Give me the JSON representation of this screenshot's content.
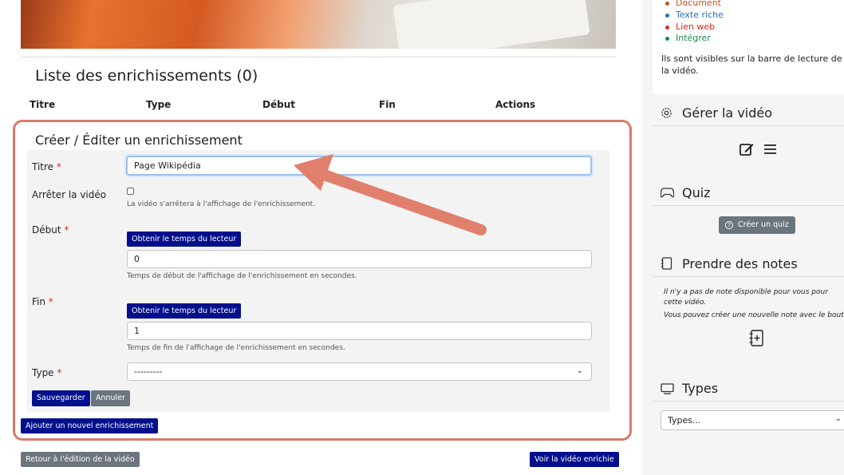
{
  "enrichment_list": {
    "title": "Liste des enrichissements (0)",
    "columns": [
      "Titre",
      "Type",
      "Début",
      "Fin",
      "Actions"
    ]
  },
  "form": {
    "title": "Créer / Éditer un enrichissement",
    "required_mark": "*",
    "titre_label": "Titre",
    "titre_value": "Page Wikipédia",
    "stop_label": "Arrêter la vidéo",
    "stop_help": "La vidéo s'arrêtera à l'affichage de l'enrichissement.",
    "start_label": "Début",
    "get_time_button": "Obtenir le temps du lecteur",
    "start_value": "0",
    "start_help": "Temps de début de l'affichage de l'enrichissement en secondes.",
    "end_label": "Fin",
    "end_value": "1",
    "end_help": "Temps de fin de l'affichage de l'enrichissement en secondes.",
    "type_label": "Type",
    "type_value": "---------",
    "save_button": "Sauvegarder",
    "cancel_button": "Annuler",
    "add_button": "Ajouter un nouvel enrichissement"
  },
  "footer": {
    "back_button": "Retour à l'édition de la vidéo",
    "view_button": "Voir la vidéo enrichie"
  },
  "sidebar": {
    "types_list": [
      {
        "label": "Document",
        "color": "#c0561c"
      },
      {
        "label": "Texte riche",
        "color": "#1e6fc4"
      },
      {
        "label": "Lien web",
        "color": "#d9292b"
      },
      {
        "label": "Intégrer",
        "color": "#1d8a4f"
      }
    ],
    "visible_text": "Ils sont visibles sur la barre de lecture de la vidéo.",
    "manage_title": "Gérer la vidéo",
    "quiz_title": "Quiz",
    "create_quiz_button": "Créer un quiz",
    "notes_title": "Prendre des notes",
    "notes_text_1": "Il n'y a pas de note disponible pour vous pour cette vidéo.",
    "notes_text_2": "Vous pouvez créer une nouvelle note avec le bouton +",
    "types_title": "Types",
    "types_select_value": "Types..."
  },
  "colors": {
    "accent_navy": "#000f8c",
    "highlight_border": "#d9796b",
    "arrow": "#e0806c",
    "grey_button": "#6c757d"
  }
}
